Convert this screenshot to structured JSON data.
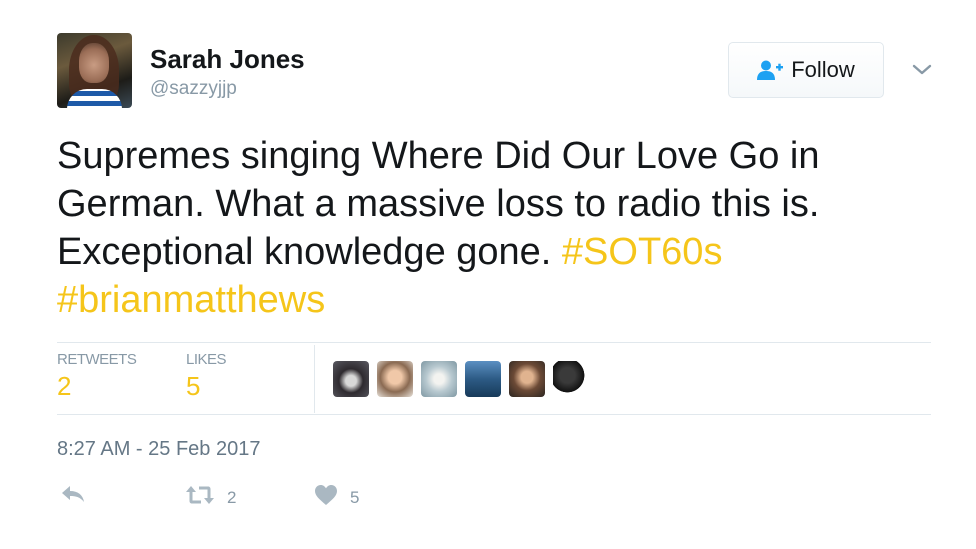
{
  "user": {
    "name": "Sarah Jones",
    "handle": "@sazzyjjp"
  },
  "follow_button": {
    "label": "Follow"
  },
  "tweet": {
    "lines": [
      [
        "Supremes singing Where Did Our Love Go in",
        ""
      ],
      [
        "German. What a massive loss to radio this is.",
        ""
      ],
      [
        "Exceptional knowledge gone.  ",
        "#SOT60s"
      ],
      [
        "",
        "#brianmatthews"
      ]
    ]
  },
  "stats": {
    "retweets_label": "RETWEETS",
    "retweets_count": "2",
    "likes_label": "LIKES",
    "likes_count": "5"
  },
  "likers": [
    {
      "name": "liker-avatar-1"
    },
    {
      "name": "liker-avatar-2"
    },
    {
      "name": "liker-avatar-3"
    },
    {
      "name": "liker-avatar-4"
    },
    {
      "name": "liker-avatar-5"
    },
    {
      "name": "liker-avatar-6"
    }
  ],
  "timestamp": "8:27 AM - 25 Feb 2017",
  "actions": {
    "retweet_count": "2",
    "like_count": "5"
  },
  "colors": {
    "accent": "#f5c51a",
    "text": "#14171a",
    "muted": "#8899a6",
    "follow_icon": "#1da1f2",
    "border": "#e1e8ed"
  },
  "icons": {
    "follow": "add-user-icon",
    "menu": "chevron-down-icon",
    "reply": "reply-icon",
    "retweet": "retweet-icon",
    "like": "heart-icon"
  }
}
